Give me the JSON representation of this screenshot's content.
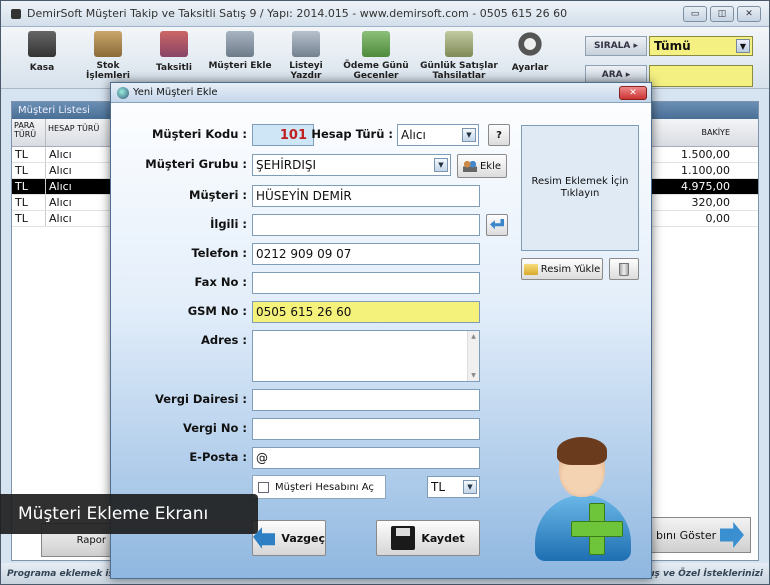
{
  "window": {
    "title": "DemirSoft Müşteri Takip ve Taksitli Satış 9 / Yapı: 2014.015 - www.demirsoft.com - 0505 615 26 60",
    "controls": [
      "▭",
      "◫",
      "✕"
    ]
  },
  "toolbar": {
    "items": [
      {
        "label": "Kasa",
        "icon": "cash-register-icon"
      },
      {
        "label": "Stok İşlemleri",
        "icon": "box-icon"
      },
      {
        "label": "Taksitli",
        "icon": "installment-icon"
      },
      {
        "label": "Müşteri Ekle",
        "icon": "customer-add-icon"
      },
      {
        "label": "Listeyi Yazdır",
        "icon": "print-list-icon"
      },
      {
        "label": "Ödeme Günü Gecenler",
        "icon": "payment-icon"
      },
      {
        "label": "Günlük Satışlar Tahsilatlar",
        "icon": "daily-sales-icon"
      },
      {
        "label": "Ayarlar",
        "icon": "gear-icon"
      }
    ],
    "sort_label": "SIRALA",
    "sort_value": "Tümü",
    "search_label": "ARA",
    "search_value": ""
  },
  "list": {
    "title": "Müşteri Listesi",
    "col_currency": "PARA TÜRÜ",
    "col_account": "HESAP TÜRÜ",
    "col_balance": "BAKİYE",
    "rows": [
      {
        "currency": "TL",
        "account": "Alıcı",
        "balance": "1.500,00",
        "selected": false
      },
      {
        "currency": "TL",
        "account": "Alıcı",
        "balance": "1.100,00",
        "selected": false
      },
      {
        "currency": "TL",
        "account": "Alıcı",
        "balance": "4.975,00",
        "selected": true
      },
      {
        "currency": "TL",
        "account": "Alıcı",
        "balance": "320,00",
        "selected": false
      },
      {
        "currency": "TL",
        "account": "Alıcı",
        "balance": "0,00",
        "selected": false
      }
    ]
  },
  "bottom": {
    "left_button": "Rapor",
    "right_button": "bını Göster",
    "status_left": "Programa eklemek iste",
    "status_right": "atış ve Özel İsteklerinizi"
  },
  "dialog": {
    "title": "Yeni Müşteri Ekle",
    "close": "✕",
    "labels": {
      "code": "Müşteri Kodu :",
      "account_type": "Hesap Türü :",
      "group": "Müşteri Grubu :",
      "customer": "Müşteri :",
      "related": "İlgili :",
      "phone": "Telefon :",
      "fax": "Fax No :",
      "gsm": "GSM No :",
      "address": "Adres :",
      "tax_office": "Vergi Dairesi :",
      "tax_no": "Vergi No :",
      "email": "E-Posta :"
    },
    "values": {
      "code": "101",
      "account_type": "Alıcı",
      "group": "ŞEHİRDIŞI",
      "customer": "HÜSEYİN DEMİR",
      "related": "",
      "phone": "0212 909 09 07",
      "fax": "",
      "gsm": "0505 615 26 60",
      "address": "",
      "tax_office": "",
      "tax_no": "",
      "email": "@",
      "currency": "TL"
    },
    "help_button": "?",
    "group_add_button": "Ekle",
    "photo_prompt": "Resim Eklemek İçin Tıklayın",
    "photo_load_button": "Resim Yükle",
    "open_account_checkbox": "Müşteri Hesabını Aç",
    "cancel_button": "Vazgeç",
    "save_button": "Kaydet"
  },
  "caption": "Müşteri Ekleme Ekranı"
}
